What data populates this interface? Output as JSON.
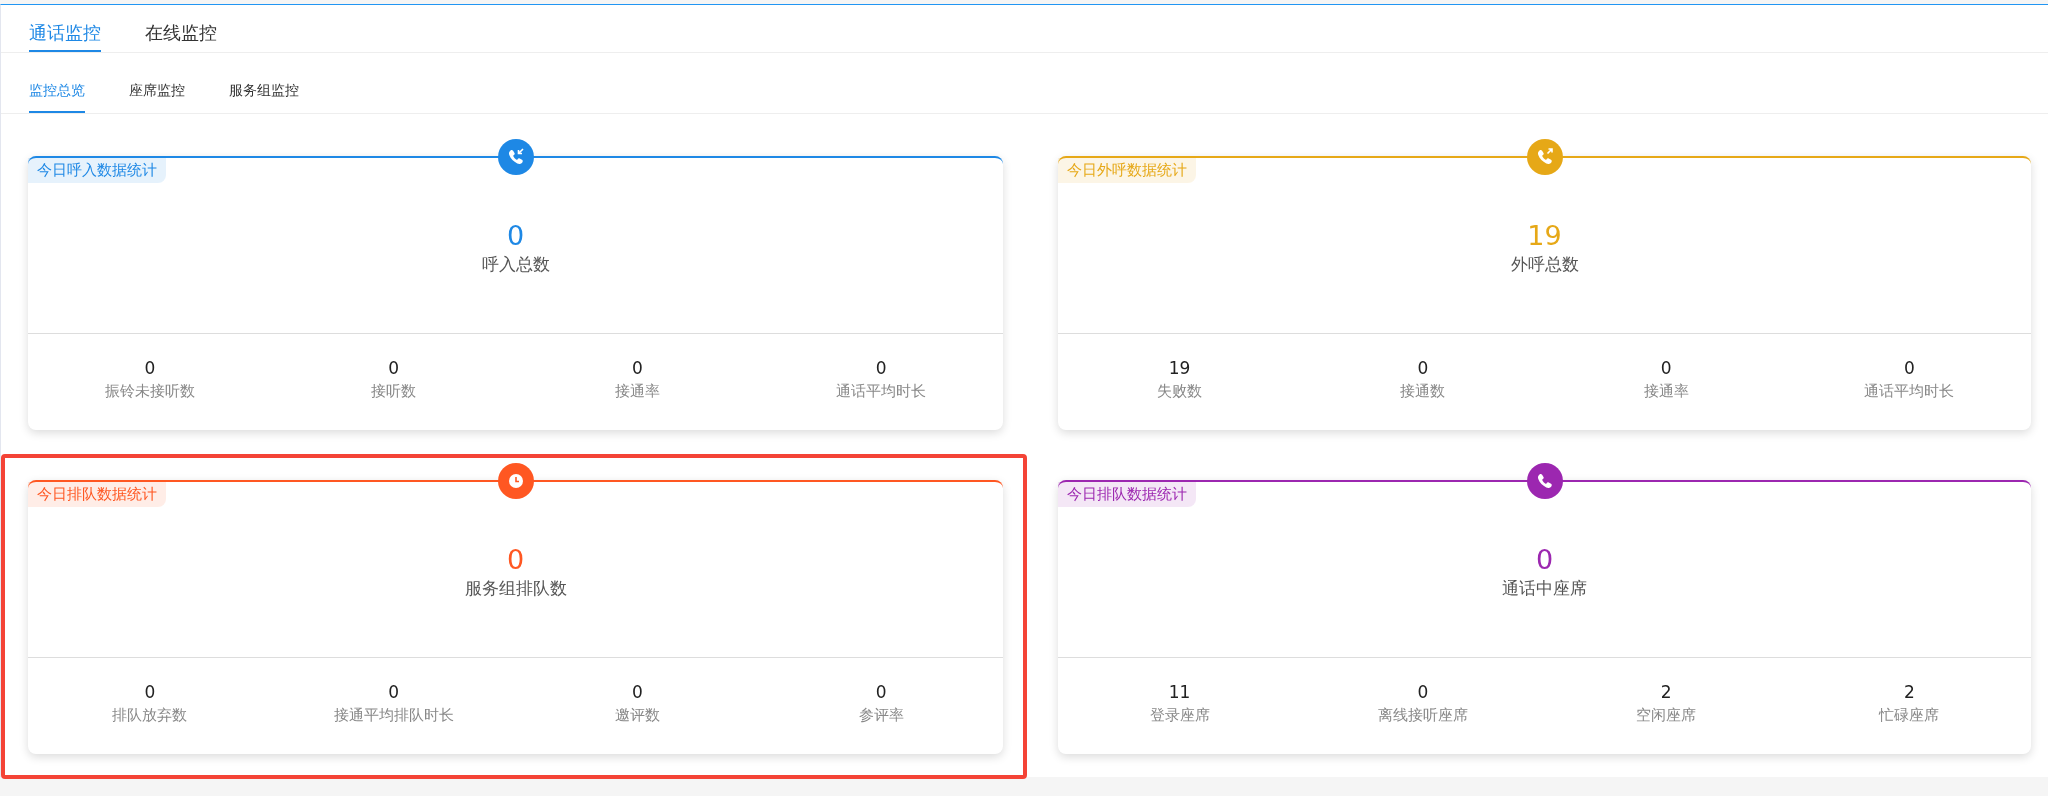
{
  "tabs": [
    {
      "label": "通话监控",
      "selected": true
    },
    {
      "label": "在线监控",
      "selected": false
    }
  ],
  "subtabs": [
    {
      "label": "监控总览",
      "selected": true
    },
    {
      "label": "座席监控",
      "selected": false
    },
    {
      "label": "服务组监控",
      "selected": false
    }
  ],
  "cards": [
    {
      "title": "今日呼入数据统计",
      "color": "#1e88e5",
      "kind": "phone-in",
      "highlighted": false,
      "value": "0",
      "label": "呼入总数",
      "stats": [
        {
          "value": "0",
          "label": "振铃未接听数"
        },
        {
          "value": "0",
          "label": "接听数"
        },
        {
          "value": "0",
          "label": "接通率"
        },
        {
          "value": "0",
          "label": "通话平均时长"
        }
      ]
    },
    {
      "title": "今日外呼数据统计",
      "color": "#e6a817",
      "kind": "phone-out",
      "highlighted": false,
      "value": "19",
      "label": "外呼总数",
      "stats": [
        {
          "value": "19",
          "label": "失败数"
        },
        {
          "value": "0",
          "label": "接通数"
        },
        {
          "value": "0",
          "label": "接通率"
        },
        {
          "value": "0",
          "label": "通话平均时长"
        }
      ]
    },
    {
      "title": "今日排队数据统计",
      "color": "#ff5722",
      "kind": "clock",
      "highlighted": true,
      "value": "0",
      "label": "服务组排队数",
      "stats": [
        {
          "value": "0",
          "label": "排队放弃数"
        },
        {
          "value": "0",
          "label": "接通平均排队时长"
        },
        {
          "value": "0",
          "label": "邀评数"
        },
        {
          "value": "0",
          "label": "参评率"
        }
      ]
    },
    {
      "title": "今日排队数据统计",
      "color": "#9c27b0",
      "kind": "phone",
      "highlighted": false,
      "value": "0",
      "label": "通话中座席",
      "stats": [
        {
          "value": "11",
          "label": "登录座席"
        },
        {
          "value": "0",
          "label": "离线接听座席"
        },
        {
          "value": "2",
          "label": "空闲座席"
        },
        {
          "value": "2",
          "label": "忙碌座席"
        }
      ]
    }
  ]
}
